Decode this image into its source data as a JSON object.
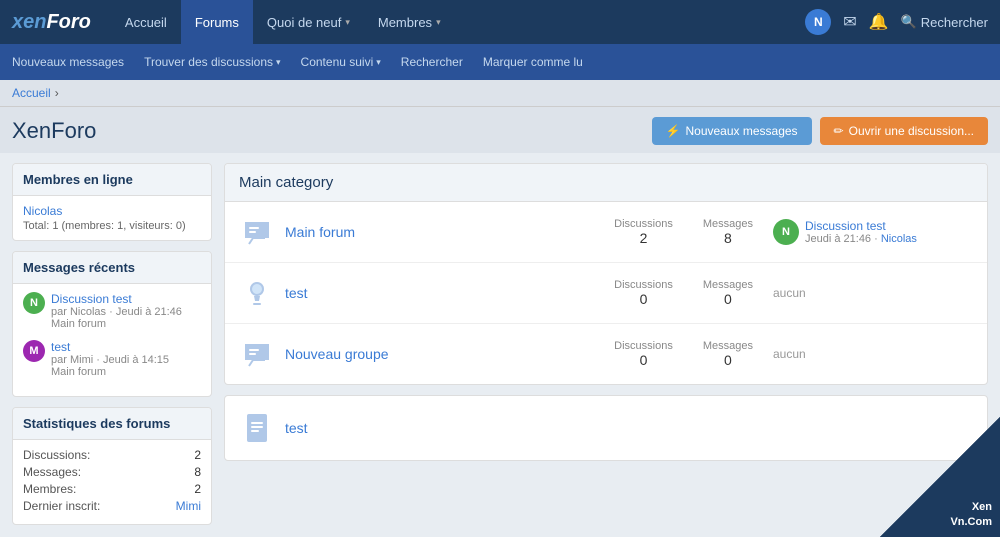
{
  "logo": {
    "text": "xen",
    "text2": "Foro"
  },
  "nav": {
    "tabs": [
      {
        "label": "Accueil",
        "active": false
      },
      {
        "label": "Forums",
        "active": true
      },
      {
        "label": "Quoi de neuf",
        "active": false,
        "hasArrow": true
      },
      {
        "label": "Membres",
        "active": false,
        "hasArrow": true
      }
    ],
    "user": "Nicolas",
    "user_initial": "N",
    "search_label": "Rechercher"
  },
  "subnav": {
    "items": [
      {
        "label": "Nouveaux messages"
      },
      {
        "label": "Trouver des discussions",
        "hasArrow": true
      },
      {
        "label": "Contenu suivi",
        "hasArrow": true
      },
      {
        "label": "Rechercher"
      },
      {
        "label": "Marquer comme lu"
      }
    ]
  },
  "breadcrumb": {
    "items": [
      "Accueil"
    ]
  },
  "page": {
    "title": "XenForo",
    "btn_new": "Nouveaux messages",
    "btn_open": "Ouvrir une discussion..."
  },
  "sidebar": {
    "online": {
      "title": "Membres en ligne",
      "members": [
        "Nicolas"
      ],
      "total": "Total: 1 (membres: 1, visiteurs: 0)"
    },
    "recent": {
      "title": "Messages récents",
      "items": [
        {
          "avatar_initial": "N",
          "avatar_color": "green",
          "title": "Discussion test",
          "author": "Nicolas",
          "date": "Jeudi à 21:46",
          "forum": "Main forum"
        },
        {
          "avatar_initial": "M",
          "avatar_color": "purple",
          "title": "test",
          "author": "Mimi",
          "date": "Jeudi à 14:15",
          "forum": "Main forum"
        }
      ]
    },
    "stats": {
      "title": "Statistiques des forums",
      "rows": [
        {
          "label": "Discussions:",
          "value": "2",
          "blue": false
        },
        {
          "label": "Messages:",
          "value": "8",
          "blue": false
        },
        {
          "label": "Membres:",
          "value": "2",
          "blue": false
        },
        {
          "label": "Dernier inscrit:",
          "value": "Mimi",
          "blue": true
        }
      ]
    }
  },
  "forum": {
    "main_category": {
      "title": "Main category",
      "forums": [
        {
          "name": "Main forum",
          "icon_type": "chat",
          "discussions": 2,
          "messages": 8,
          "last_title": "Discussion test",
          "last_date": "Jeudi à 21:46",
          "last_user": "Nicolas",
          "last_avatar": "N",
          "last_avatar_color": "#4caf50",
          "has_last": true
        },
        {
          "name": "test",
          "icon_type": "light",
          "discussions": 0,
          "messages": 0,
          "has_last": false,
          "last_none": "aucun"
        },
        {
          "name": "Nouveau groupe",
          "icon_type": "chat",
          "discussions": 0,
          "messages": 0,
          "has_last": false,
          "last_none": "aucun"
        }
      ]
    },
    "plain_category": {
      "forums": [
        {
          "name": "test",
          "icon_type": "doc"
        }
      ]
    }
  },
  "labels": {
    "discussions": "Discussions",
    "messages": "Messages",
    "accueil": "Accueil",
    "par": "par",
    "dot": "·"
  },
  "watermark": {
    "line1": "Xen",
    "line2": "Vn.Com"
  }
}
